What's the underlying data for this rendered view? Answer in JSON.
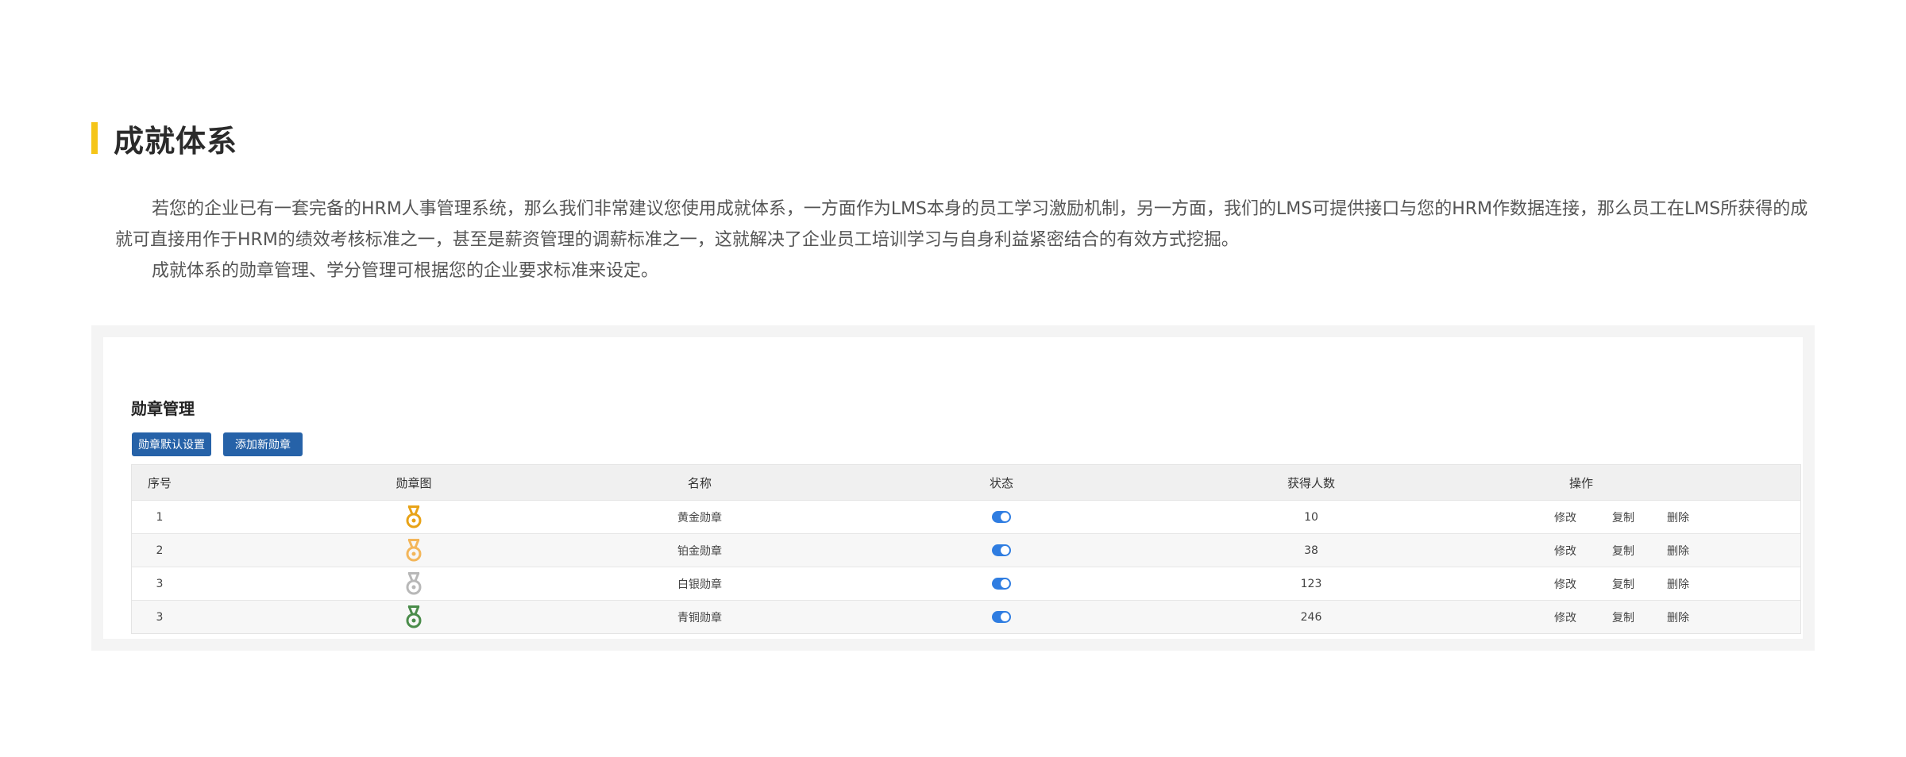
{
  "section": {
    "title": "成就体系",
    "paragraph1": "若您的企业已有一套完备的HRM人事管理系统，那么我们非常建议您使用成就体系，一方面作为LMS本身的员工学习激励机制，另一方面，我们的LMS可提供接口与您的HRM作数据连接，那么员工在LMS所获得的成就可直接用作于HRM的绩效考核标准之一，甚至是薪资管理的调薪标准之一，这就解决了企业员工培训学习与自身利益紧密结合的有效方式挖掘。",
    "paragraph2": "成就体系的勋章管理、学分管理可根据您的企业要求标准来设定。"
  },
  "panel": {
    "title": "勋章管理",
    "btn_default": "勋章默认设置",
    "btn_add": "添加新勋章"
  },
  "table": {
    "headers": {
      "no": "序号",
      "icon": "勋章图",
      "name": "名称",
      "status": "状态",
      "count": "获得人数",
      "ops": "操作"
    },
    "op_labels": {
      "edit": "修改",
      "copy": "复制",
      "delete": "删除"
    },
    "rows": [
      {
        "no": "1",
        "name": "黄金勋章",
        "count": "10",
        "icon": "gold-medal-icon",
        "color": "#e8a317",
        "enabled": true
      },
      {
        "no": "2",
        "name": "铂金勋章",
        "count": "38",
        "icon": "platinum-medal-icon",
        "color": "#f3b65a",
        "enabled": true
      },
      {
        "no": "3",
        "name": "白银勋章",
        "count": "123",
        "icon": "silver-medal-icon",
        "color": "#b8b8b8",
        "enabled": true
      },
      {
        "no": "3",
        "name": "青铜勋章",
        "count": "246",
        "icon": "bronze-medal-icon",
        "color": "#4a8c4a",
        "enabled": true
      }
    ]
  },
  "colors": {
    "accent": "#f5c518",
    "button": "#2662a8",
    "toggle": "#2f7de1"
  }
}
